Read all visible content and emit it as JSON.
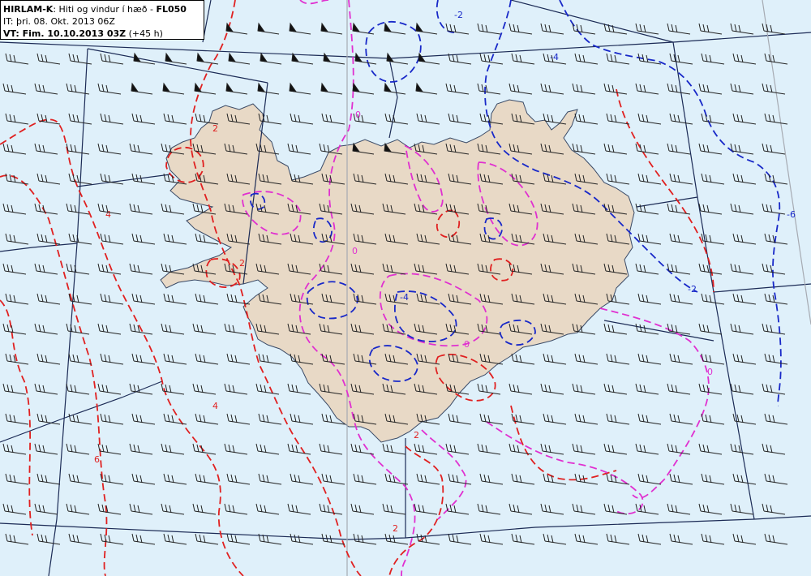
{
  "header": {
    "model": "HIRLAM-K",
    "description": ": Hiti og vindur í hæð - ",
    "level": "FL050",
    "it_text": "IT: þri. 08. Okt. 2013 06Z",
    "vt_label": "VT: Fim. 10.10.2013 03Z",
    "vt_suffix": " (+45 h)"
  },
  "colors": {
    "sea": "#dff0fa",
    "land": "#e8d9c6",
    "coast": "#3a4a66",
    "grid": "#1b2a55",
    "meridian": "#a6aab2",
    "contour_warm": "#e02020",
    "contour_zero": "#e030d0",
    "contour_cold": "#1828c8",
    "barb": "#222222"
  },
  "contour_labels": [
    {
      "text": "-2",
      "color": "blue"
    },
    {
      "text": "-4",
      "color": "blue"
    },
    {
      "text": "-6",
      "color": "blue"
    },
    {
      "text": "-2",
      "color": "blue"
    },
    {
      "text": "-4",
      "color": "blue"
    },
    {
      "text": "0",
      "color": "magenta"
    },
    {
      "text": "0",
      "color": "magenta"
    },
    {
      "text": "0",
      "color": "magenta"
    },
    {
      "text": "0",
      "color": "magenta"
    },
    {
      "text": "2",
      "color": "red"
    },
    {
      "text": "2",
      "color": "red"
    },
    {
      "text": "2",
      "color": "red"
    },
    {
      "text": "2",
      "color": "red"
    },
    {
      "text": "4",
      "color": "red"
    },
    {
      "text": "4",
      "color": "red"
    },
    {
      "text": "6",
      "color": "red"
    }
  ],
  "wind": {
    "calm_region_style": "pennant",
    "open_region_style": "barbs"
  }
}
